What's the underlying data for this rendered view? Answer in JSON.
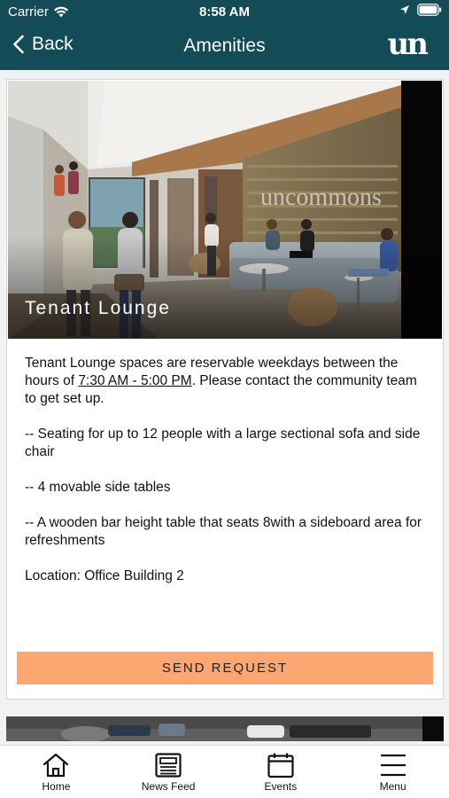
{
  "status_bar": {
    "carrier": "Carrier",
    "time": "8:58 AM"
  },
  "nav": {
    "back_label": "Back",
    "title": "Amenities",
    "logo": "un"
  },
  "amenity": {
    "image_caption": "Tenant Lounge",
    "description_line1": "Tenant Lounge spaces are reservable weekdays between the hours of ",
    "hours": "7:30 AM - 5:00 PM",
    "description_line1_end": ". Please contact the community team to get set up.",
    "features": [
      "--  Seating for up to 12 people with a large sectional sofa and side chair",
      "--  4 movable side tables",
      "--  A wooden bar height table that seats 8with a sideboard area for refreshments"
    ],
    "location": "Location: Office Building 2",
    "wall_sign": "uncommons",
    "button_label": "SEND REQUEST"
  },
  "tabs": [
    {
      "label": "Home",
      "icon": "home-icon"
    },
    {
      "label": "News Feed",
      "icon": "newspaper-icon"
    },
    {
      "label": "Events",
      "icon": "calendar-icon"
    },
    {
      "label": "Menu",
      "icon": "hamburger-icon"
    }
  ]
}
